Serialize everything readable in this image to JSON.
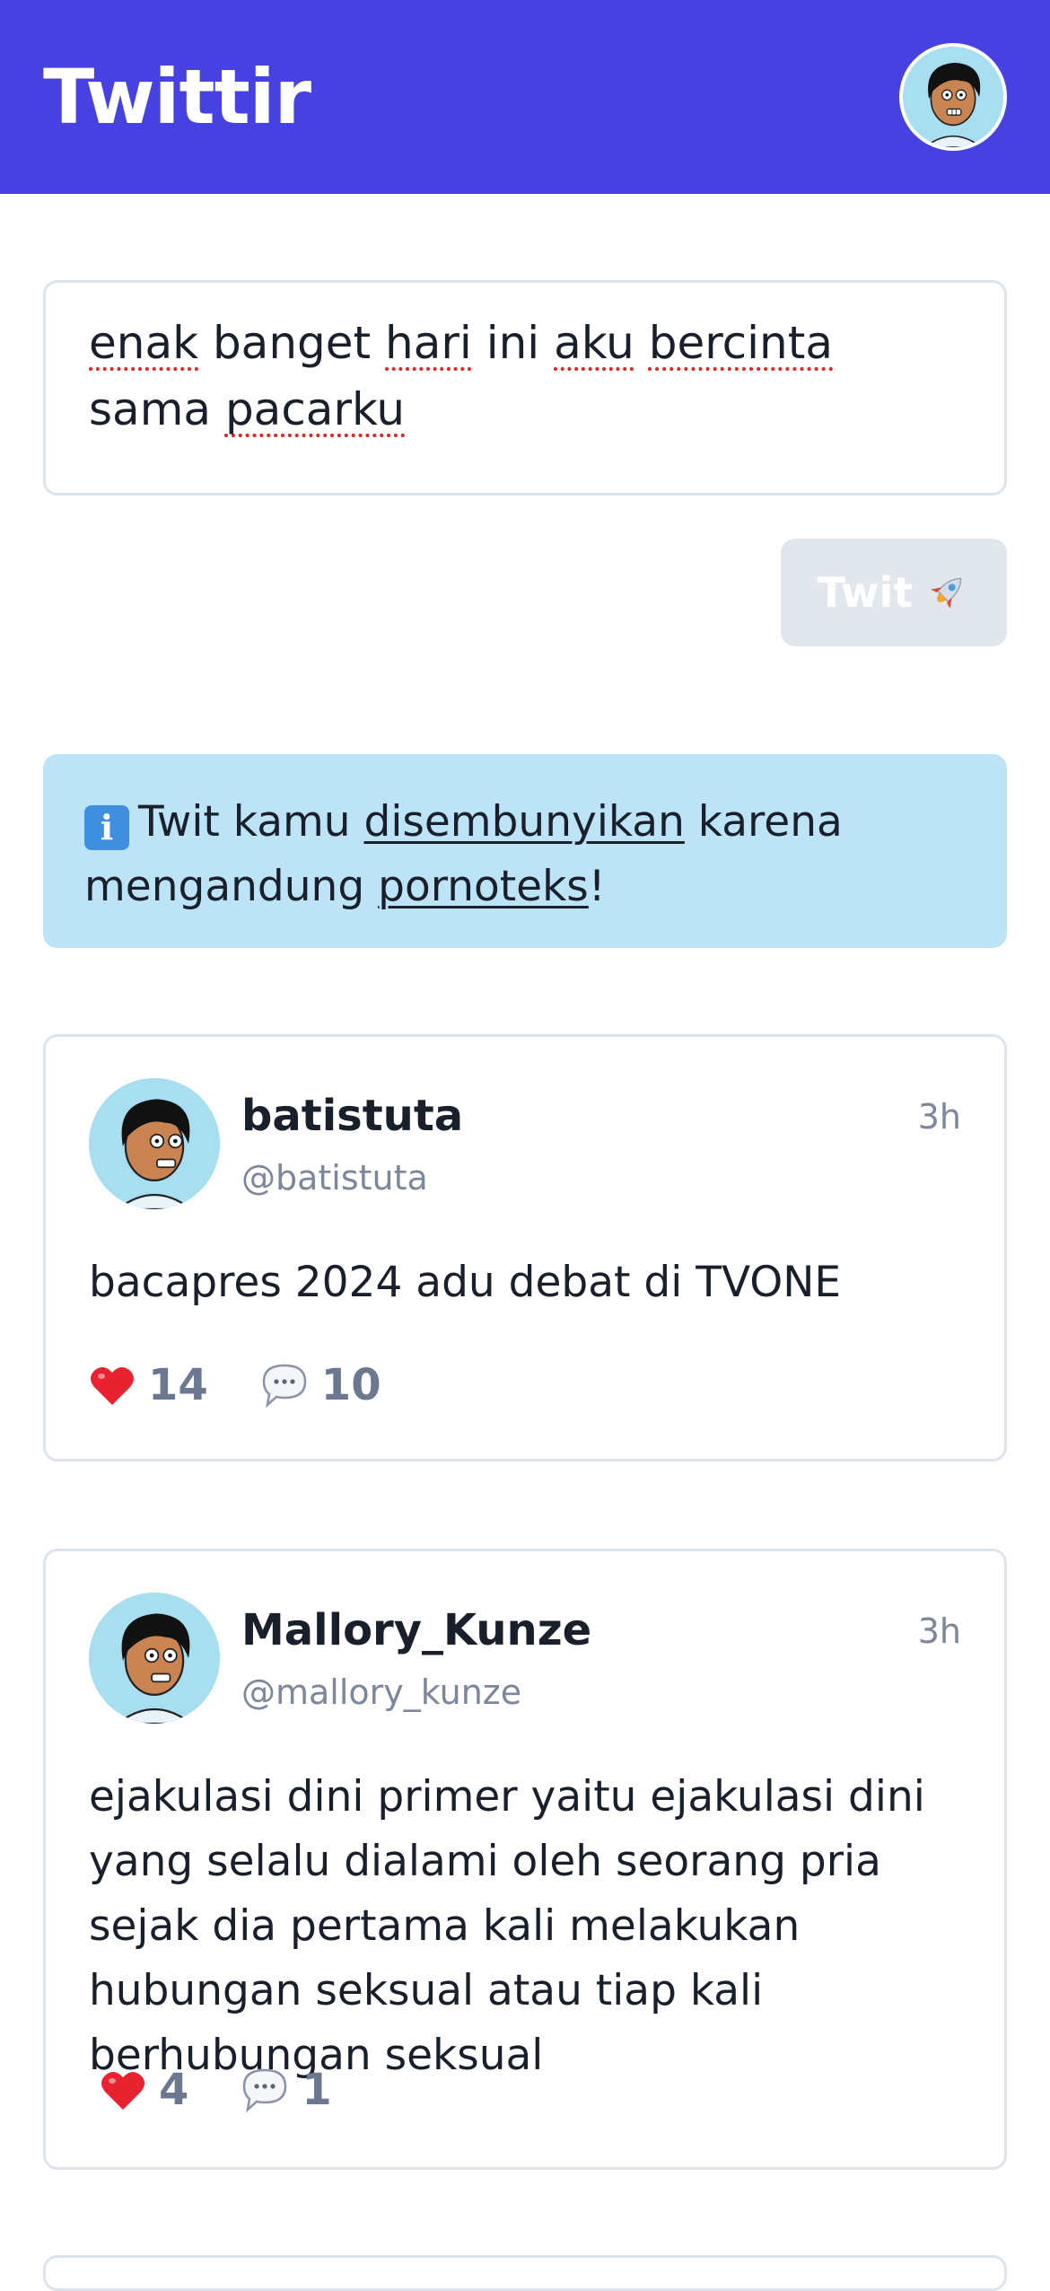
{
  "header": {
    "brand": "Twittir"
  },
  "composer": {
    "text_words": [
      "enak",
      " banget ",
      "hari",
      " ini ",
      "aku",
      " ",
      "bercinta",
      " sama ",
      "pacarku"
    ]
  },
  "twit_button": {
    "label": "Twit",
    "icon": "rocket-icon"
  },
  "notice": {
    "icon": "info-icon",
    "part1": "Twit kamu ",
    "link1": "disembunyikan",
    "part2": " karena mengandung ",
    "link2": "pornoteks",
    "part3": "!"
  },
  "posts": [
    {
      "name": "batistuta",
      "handle": "@batistuta",
      "time": "3h",
      "body": "bacapres 2024 adu debat di TVONE",
      "likes": "14",
      "comments": "10"
    },
    {
      "name": "Mallory_Kunze",
      "handle": "@mallory_kunze",
      "time": "3h",
      "body": "ejakulasi dini primer yaitu ejakulasi dini yang selalu dialami oleh seorang pria sejak dia pertama kali melakukan hubungan seksual atau tiap kali berhubungan seksual",
      "likes": "4",
      "comments": "1"
    }
  ],
  "colors": {
    "header_bg": "#4641e0",
    "notice_bg": "#bde3f7",
    "button_disabled_bg": "#e2e7ee",
    "heart_red": "#e8232f"
  }
}
